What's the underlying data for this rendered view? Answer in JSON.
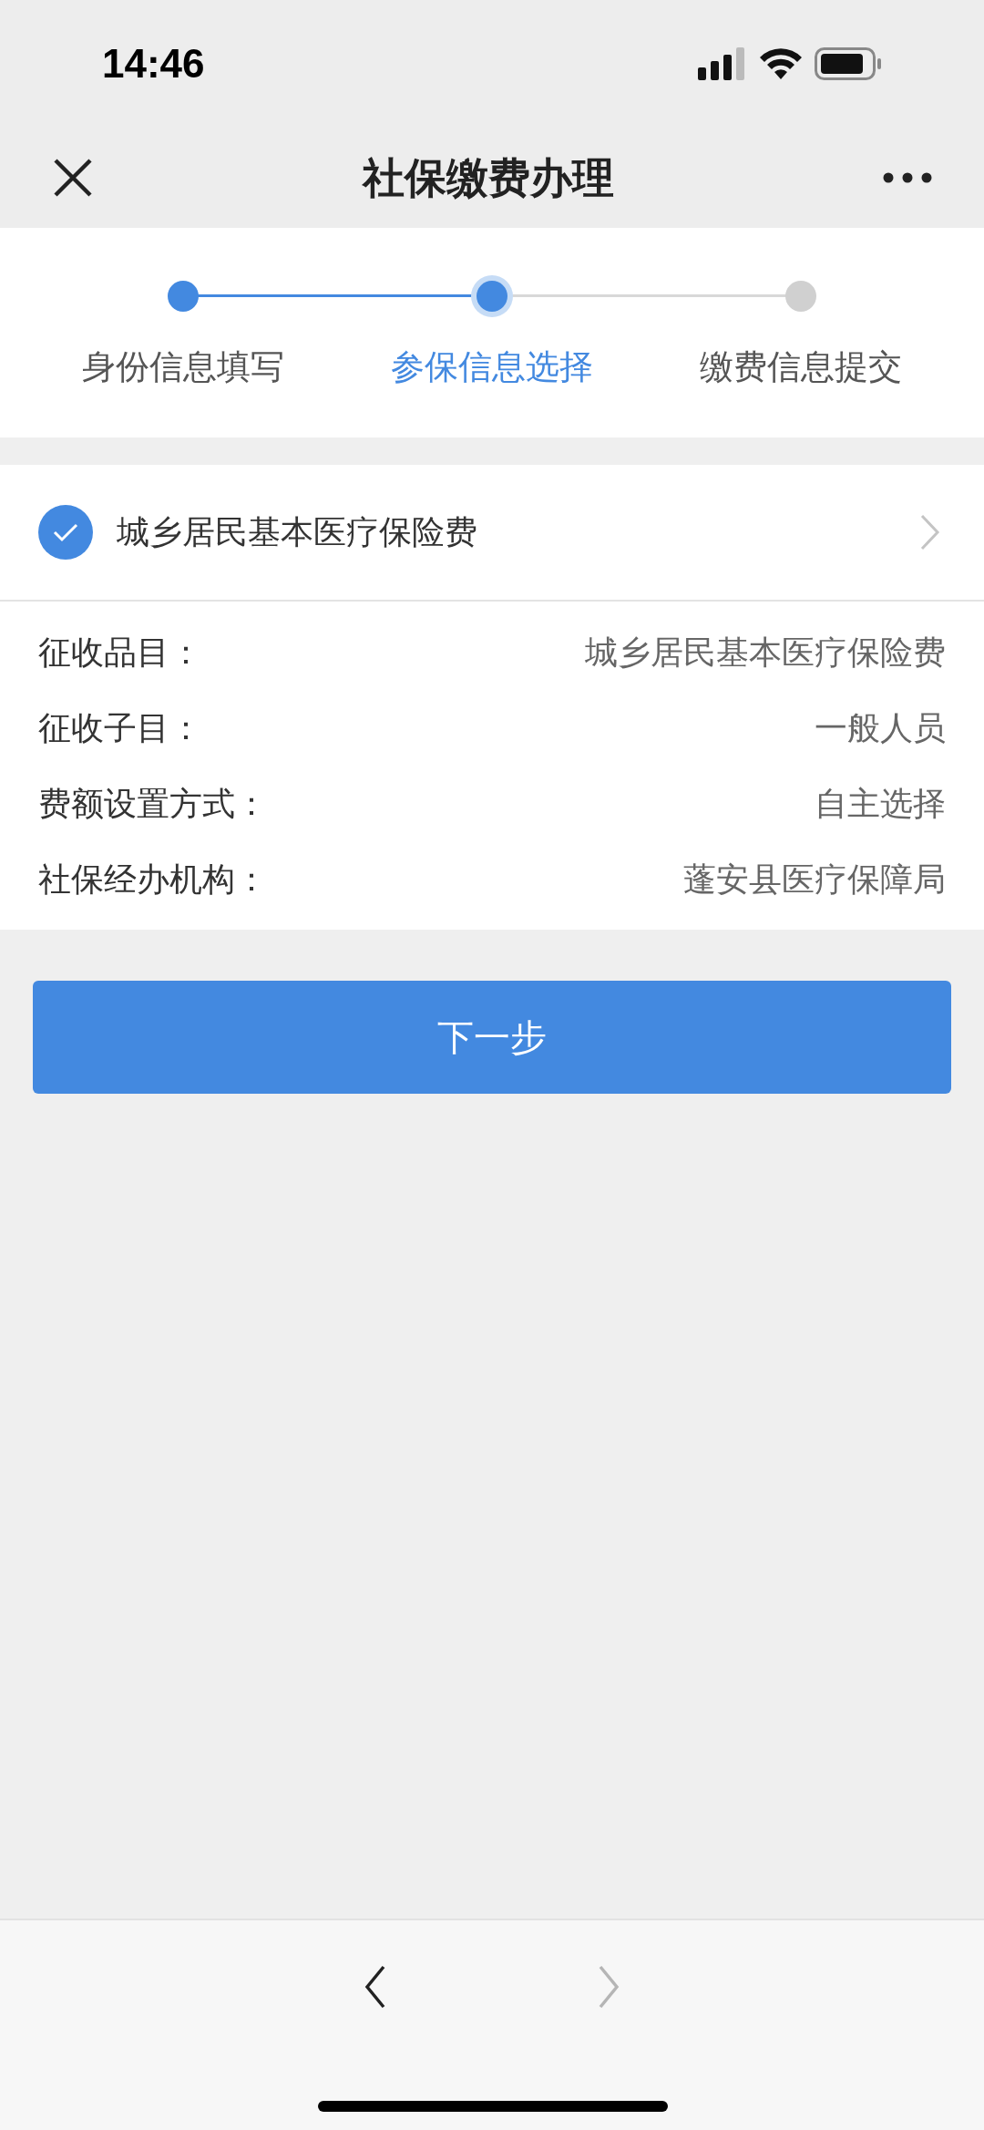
{
  "status_bar": {
    "time": "14:46"
  },
  "nav_bar": {
    "title": "社保缴费办理"
  },
  "steps": [
    {
      "label": "身份信息填写",
      "completed": true,
      "selected": false
    },
    {
      "label": "参保信息选择",
      "completed": false,
      "selected": true
    },
    {
      "label": "缴费信息提交",
      "completed": false,
      "selected": false
    }
  ],
  "insurance": {
    "title": "城乡居民基本医疗保险费",
    "checked": true
  },
  "details": [
    {
      "label": "征收品目：",
      "value": "城乡居民基本医疗保险费"
    },
    {
      "label": "征收子目：",
      "value": "一般人员"
    },
    {
      "label": "费额设置方式：",
      "value": "自主选择"
    },
    {
      "label": "社保经办机构：",
      "value": "蓬安县医疗保障局"
    }
  ],
  "next_button": "下一步",
  "bottom_bar": {
    "back_disabled": false,
    "forward_disabled": true
  }
}
